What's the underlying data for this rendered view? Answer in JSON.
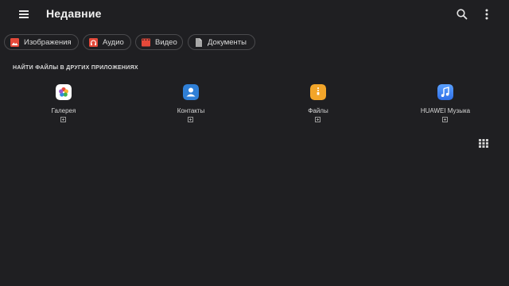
{
  "toolbar": {
    "title": "Недавние",
    "menu_icon": "hamburger-menu-icon",
    "search_icon": "search-icon",
    "more_icon": "more-vertical-icon"
  },
  "chips": [
    {
      "label": "Изображения",
      "icon": "image-icon",
      "color": "#e5493a"
    },
    {
      "label": "Аудио",
      "icon": "audio-icon",
      "color": "#e5493a"
    },
    {
      "label": "Видео",
      "icon": "video-icon",
      "color": "#e5493a"
    },
    {
      "label": "Документы",
      "icon": "document-icon",
      "color": "#a8a8a8"
    }
  ],
  "section": {
    "title": "НАЙТИ ФАЙЛЫ В ДРУГИХ ПРИЛОЖЕНИЯХ"
  },
  "apps": [
    {
      "label": "Галерея",
      "icon": "gallery-icon",
      "color": "#ffffff"
    },
    {
      "label": "Контакты",
      "icon": "contacts-icon",
      "color": "#2f7fd6"
    },
    {
      "label": "Файлы",
      "icon": "files-icon",
      "color": "#f2a52a"
    },
    {
      "label": "HUAWEI Музыка",
      "icon": "music-icon",
      "color": "#3f7ff0"
    }
  ],
  "view_toggle_icon": "grid-view-icon"
}
